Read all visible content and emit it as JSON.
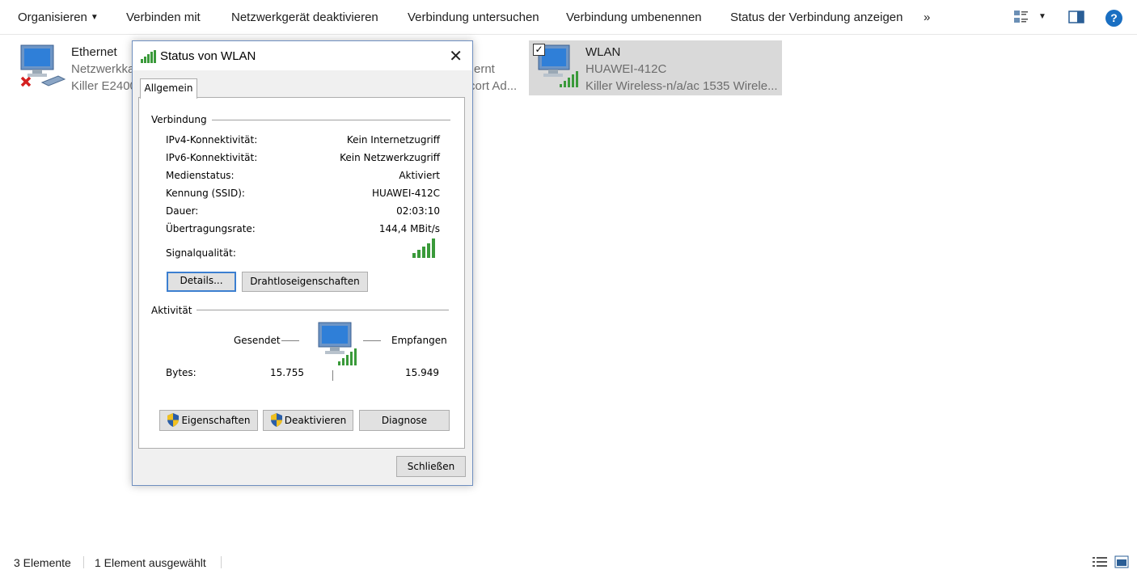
{
  "toolbar": {
    "organize": "Organisieren",
    "connect": "Verbinden mit",
    "disable_device": "Netzwerkgerät deaktivieren",
    "diagnose_connection": "Verbindung untersuchen",
    "rename_connection": "Verbindung umbenennen",
    "show_status": "Status der Verbindung anzeigen",
    "more": "»",
    "help": "?"
  },
  "items": [
    {
      "name": "Ethernet",
      "line2": "Netzwerkka",
      "line3": "Killer E2400"
    },
    {
      "name": "",
      "line2": "ernt",
      "line3": "cort Ad..."
    },
    {
      "name": "WLAN",
      "line2": "HUAWEI-412C",
      "line3": "Killer Wireless-n/a/ac 1535 Wirele..."
    }
  ],
  "statusbar": {
    "count": "3 Elemente",
    "selected": "1 Element ausgewählt"
  },
  "dialog": {
    "title": "Status von WLAN",
    "close": "✕",
    "tab": "Allgemein",
    "connection_group": "Verbindung",
    "rows": [
      {
        "label": "IPv4-Konnektivität:",
        "value": "Kein Internetzugriff"
      },
      {
        "label": "IPv6-Konnektivität:",
        "value": "Kein Netzwerkzugriff"
      },
      {
        "label": "Medienstatus:",
        "value": "Aktiviert"
      },
      {
        "label": "Kennung (SSID):",
        "value": "HUAWEI-412C"
      },
      {
        "label": "Dauer:",
        "value": "02:03:10"
      },
      {
        "label": "Übertragungsrate:",
        "value": "144,4 MBit/s"
      }
    ],
    "signal_label": "Signalqualität:",
    "signal_bars": 5,
    "details_button": "Details...",
    "wireless_props_button": "Drahtloseigenschaften",
    "activity_group": "Aktivität",
    "sent_label": "Gesendet",
    "received_label": "Empfangen",
    "bytes_label": "Bytes:",
    "bytes_sent": "15.755",
    "bytes_received": "15.949",
    "properties_button": "Eigenschaften",
    "disable_button": "Deaktivieren",
    "diagnose_button": "Diagnose",
    "close_button": "Schließen"
  },
  "colors": {
    "accent": "#1a6fc2",
    "signal_green": "#3a9a3a",
    "selection": "#d9d9d9",
    "error_red": "#d42020"
  }
}
